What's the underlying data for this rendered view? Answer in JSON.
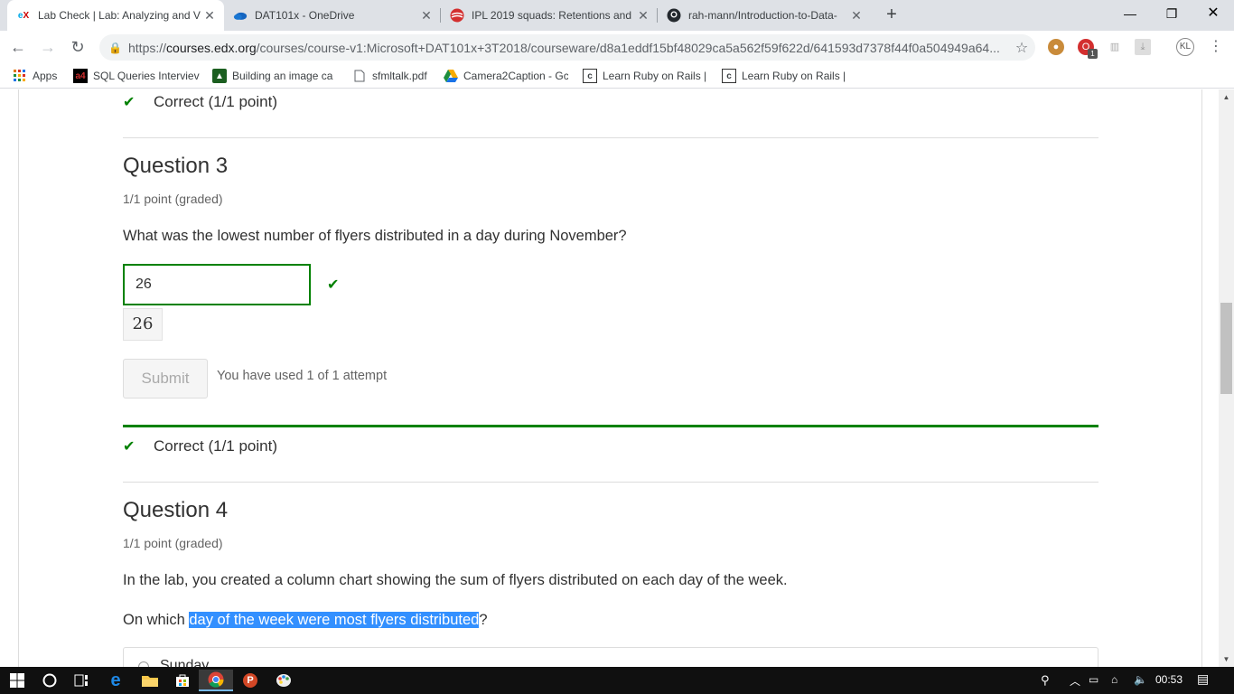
{
  "browser": {
    "tabs": [
      {
        "title": "Lab Check | Lab: Analyzing and V",
        "favicon": "edx-icon",
        "active": true
      },
      {
        "title": "DAT101x - OneDrive",
        "favicon": "onedrive-icon",
        "active": false
      },
      {
        "title": "IPL 2019 squads: Retentions and",
        "favicon": "ipl-icon",
        "active": false
      },
      {
        "title": "rah-mann/Introduction-to-Data-",
        "favicon": "github-icon",
        "active": false
      }
    ],
    "url_prefix": "https://",
    "url_host": "courses.edx.org",
    "url_path": "/courses/course-v1:Microsoft+DAT101x+3T2018/courseware/d8a1eddf15bf48029ca5a562f59f622d/641593d7378f44f0a504949a64...",
    "profile_initials": "KL",
    "ext_badge": "1",
    "bookmarks": [
      {
        "label": "Apps",
        "icon": "apps-grid-icon"
      },
      {
        "label": "SQL Queries Interviev",
        "icon": "a4-icon"
      },
      {
        "label": "Building an image ca",
        "icon": "bookmark-green-icon"
      },
      {
        "label": "sfmltalk.pdf",
        "icon": "document-icon"
      },
      {
        "label": "Camera2Caption - Gc",
        "icon": "google-drive-icon"
      },
      {
        "label": "Learn Ruby on Rails |",
        "icon": "c-icon"
      },
      {
        "label": "Learn Ruby on Rails |",
        "icon": "c-icon"
      }
    ]
  },
  "page": {
    "prev_result": "Correct (1/1 point)",
    "q3": {
      "title": "Question 3",
      "points": "1/1 point (graded)",
      "text": "What was the lowest number of flyers distributed in a day during November?",
      "answer": "26",
      "answer_preview": "26",
      "submit_label": "Submit",
      "attempts": "You have used 1 of 1 attempt",
      "result": "Correct (1/1 point)"
    },
    "q4": {
      "title": "Question 4",
      "points": "1/1 point (graded)",
      "text": "In the lab, you created a column chart showing the sum of flyers distributed on each day of the week.",
      "prompt_before": "On which ",
      "prompt_selected": "day of the week were most flyers distributed",
      "prompt_after": "?",
      "first_option": "Sunday"
    }
  },
  "taskbar": {
    "time": "00:53",
    "pinned": [
      "windows-start-icon",
      "cortana-search-icon",
      "task-view-icon",
      "edge-icon",
      "file-explorer-icon",
      "store-icon",
      "chrome-icon",
      "powerpoint-icon",
      "paint-icon"
    ]
  },
  "colors": {
    "correct_green": "#008100",
    "selection_blue": "#3390ff"
  }
}
